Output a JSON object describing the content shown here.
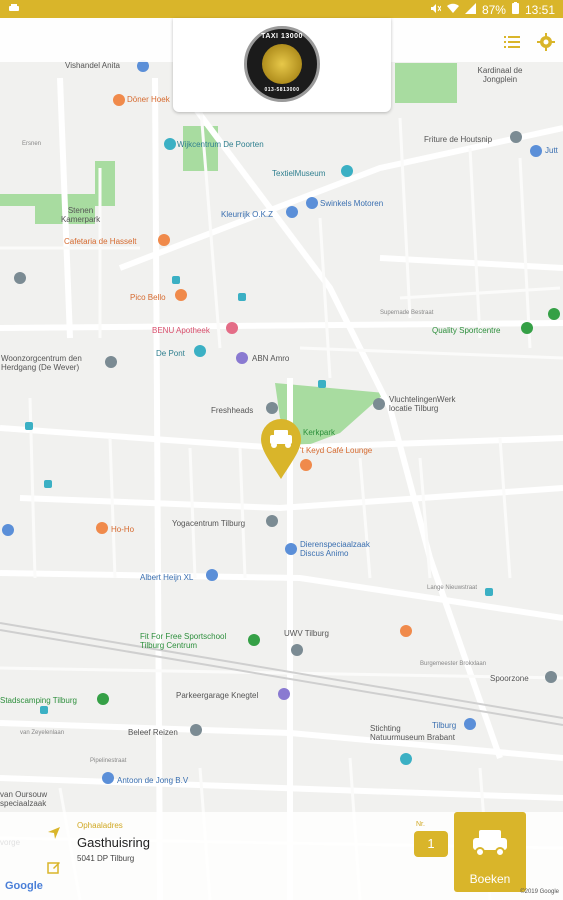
{
  "status_bar": {
    "battery": "87%",
    "time": "13:51"
  },
  "logo": {
    "top_text": "TAXI 13000",
    "bottom_text": "013-5813000"
  },
  "map": {
    "labels": [
      {
        "key": "vishandel",
        "text": "Vishandel Anita",
        "color": "gray"
      },
      {
        "key": "doner",
        "text": "Döner Hoek",
        "color": "orange"
      },
      {
        "key": "kardinaal",
        "text": "Kardinaal de Jongplein",
        "color": "gray"
      },
      {
        "key": "wijkcentrum",
        "text": "Wijkcentrum De Poorten",
        "color": "teal"
      },
      {
        "key": "friture",
        "text": "Friture de Houtsnip",
        "color": "gray"
      },
      {
        "key": "textielmuseum",
        "text": "TextielMuseum",
        "color": "teal"
      },
      {
        "key": "kleurrijk",
        "text": "Kleurrijk O.K.Z",
        "color": "blue"
      },
      {
        "key": "swinkels",
        "text": "Swinkels Motoren",
        "color": "blue"
      },
      {
        "key": "stenen",
        "text": "Stenen Kamerpark",
        "color": "gray"
      },
      {
        "key": "cafetaria",
        "text": "Cafetaria de Hasselt",
        "color": "orange"
      },
      {
        "key": "pico",
        "text": "Pico Bello",
        "color": "orange"
      },
      {
        "key": "benu",
        "text": "BENU Apotheek",
        "color": "pink"
      },
      {
        "key": "quality",
        "text": "Quality Sportcentre",
        "color": "green"
      },
      {
        "key": "woonzorg",
        "text": "Woonzorgcentrum den Herdgang (De Wever)",
        "color": "gray"
      },
      {
        "key": "depont",
        "text": "De Pont",
        "color": "teal"
      },
      {
        "key": "abn",
        "text": "ABN Amro",
        "color": "purple"
      },
      {
        "key": "freshheads",
        "text": "Freshheads",
        "color": "gray"
      },
      {
        "key": "vluchtelingen",
        "text": "VluchtelingenWerk locatie Tilburg",
        "color": "gray"
      },
      {
        "key": "kerkpark",
        "text": "Kerkpark",
        "color": "green"
      },
      {
        "key": "tkeyd",
        "text": "'t Keyd Café Lounge",
        "color": "orange"
      },
      {
        "key": "hoho",
        "text": "Ho-Ho",
        "color": "orange"
      },
      {
        "key": "yoga",
        "text": "Yogacentrum Tilburg",
        "color": "gray"
      },
      {
        "key": "dieren",
        "text": "Dierenspeciaalzaak Discus Animo",
        "color": "blue"
      },
      {
        "key": "albert",
        "text": "Albert Heijn XL",
        "color": "blue"
      },
      {
        "key": "fitforfree",
        "text": "Fit For Free Sportschool Tilburg Centrum",
        "color": "green"
      },
      {
        "key": "uwv",
        "text": "UWV Tilburg",
        "color": "gray"
      },
      {
        "key": "spoorzone",
        "text": "Spoorzone",
        "color": "gray"
      },
      {
        "key": "stadscamping",
        "text": "Stadscamping Tilburg",
        "color": "green"
      },
      {
        "key": "parkeer",
        "text": "Parkeergarage Knegtel",
        "color": "gray"
      },
      {
        "key": "stichting",
        "text": "Stichting Natuurmuseum Brabant",
        "color": "gray"
      },
      {
        "key": "tilburg",
        "text": "Tilburg",
        "color": "blue"
      },
      {
        "key": "beleef",
        "text": "Beleef Reizen",
        "color": "gray"
      },
      {
        "key": "antoon",
        "text": "Antoon de Jong B.V",
        "color": "blue"
      },
      {
        "key": "vanourou",
        "text": "van Oursouw speciaalzaak",
        "color": "gray"
      },
      {
        "key": "jutt",
        "text": "Jutt",
        "color": "blue"
      },
      {
        "key": "vorge",
        "text": "vorge",
        "color": "gray"
      }
    ]
  },
  "address": {
    "label": "Ophaaladres",
    "street": "Gasthuisring",
    "city": "5041 DP Tilburg"
  },
  "number": {
    "label": "Nr.",
    "value": "1"
  },
  "book_button": {
    "label": "Boeken"
  },
  "google_label": "Google",
  "copyright": "©2019 Google",
  "colors": {
    "accent": "#d9b52a",
    "map_bg": "#f1f1ef",
    "park": "#a8dca0"
  }
}
